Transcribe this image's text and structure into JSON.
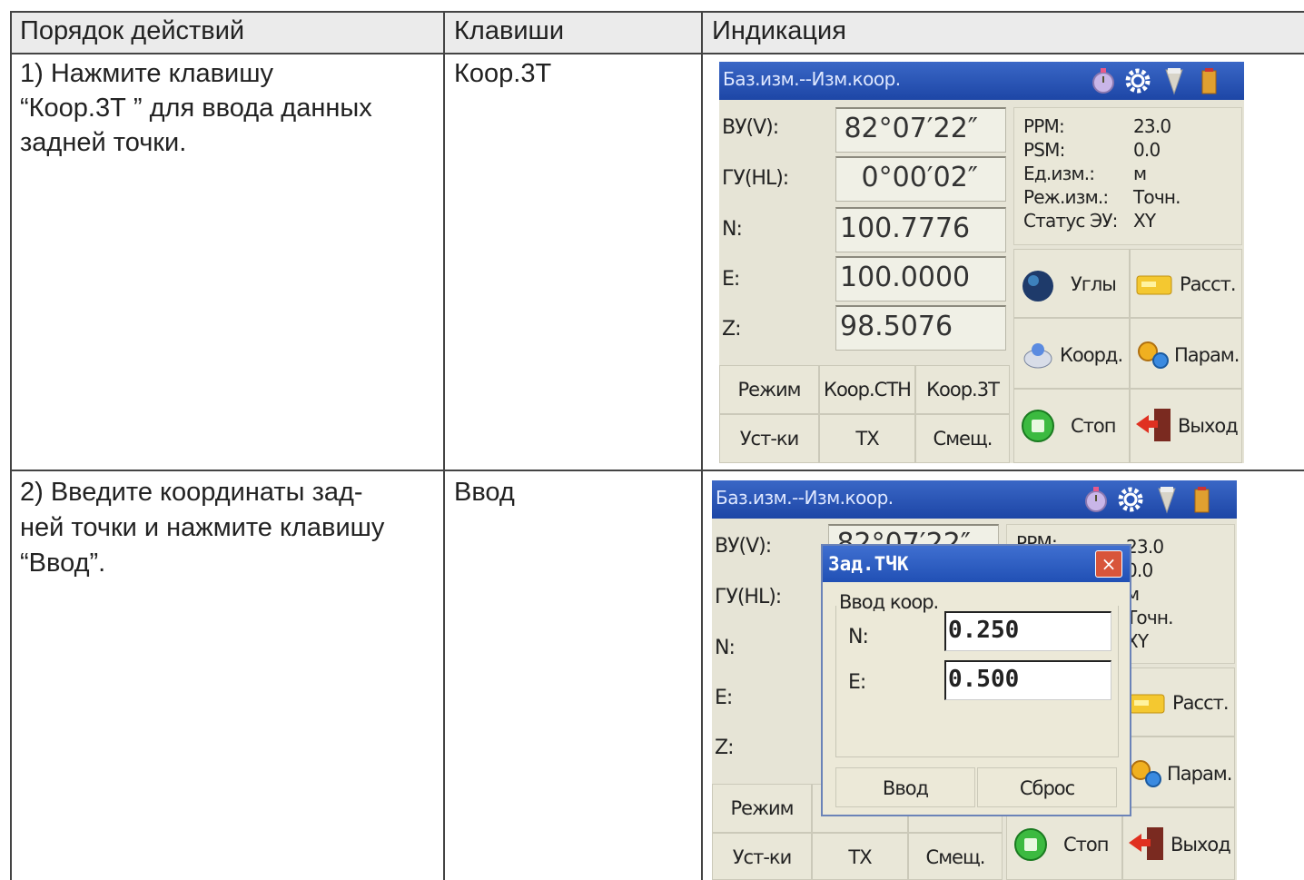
{
  "table": {
    "headers": {
      "steps": "Порядок действий",
      "keys": "Клавиши",
      "display": "Индикация"
    },
    "rows": [
      {
        "step_lines": [
          "1) Нажмите клавишу",
          "“Коор.3Т ” для ввода данных",
          "задней точки."
        ],
        "key": "Коор.3Т"
      },
      {
        "step_lines": [
          "2) Введите координаты зад-",
          "ней точки и нажмите клавишу",
          "“Ввод”."
        ],
        "key": "Ввод"
      }
    ]
  },
  "screen1": {
    "title": "Баз.изм.--Изм.коор.",
    "fields": [
      {
        "label": "ВУ(V):",
        "value": "82°07′22″"
      },
      {
        "label": "ГУ(HL):",
        "value": "0°00′02″"
      },
      {
        "label": "N:",
        "value": "100.7776"
      },
      {
        "label": "E:",
        "value": "100.0000"
      },
      {
        "label": "Z:",
        "value": "98.5076"
      }
    ],
    "info": [
      {
        "key": "PPM:",
        "value": "23.0"
      },
      {
        "key": "PSM:",
        "value": "0.0"
      },
      {
        "key": "Ед.изм.:",
        "value": "м"
      },
      {
        "key": "Реж.изм.:",
        "value": "Точн."
      },
      {
        "key": "Статус ЭУ:",
        "value": "XY"
      }
    ],
    "softkeys": [
      "Режим",
      "Коор.СТН",
      "Коор.3Т",
      "Уст-ки",
      "ТХ",
      "Смещ."
    ],
    "side_buttons": [
      "Углы",
      "Расст.",
      "Коорд.",
      "Парам.",
      "Стоп",
      "Выход"
    ]
  },
  "screen2": {
    "title": "Баз.изм.--Изм.коор.",
    "partial_value": "82°07′22″",
    "labels": [
      "ВУ(V):",
      "ГУ(HL):",
      "N:",
      "E:",
      "Z:"
    ],
    "info_partial": [
      "PPM:",
      "23.0",
      "0.0",
      "м",
      "Точн.",
      "XY"
    ],
    "softkeys": [
      "Режим",
      "Уст-ки",
      "ТХ",
      "Смещ."
    ],
    "side_buttons": [
      "Расст.",
      "Парам.",
      "Стоп",
      "Выход"
    ],
    "dialog": {
      "title": "Зад.ТЧК",
      "close": "×",
      "group_label": "Ввод коор.",
      "n_label": "N:",
      "n_value": "0.250",
      "e_label": "E:",
      "e_value": "0.500",
      "ok": "Ввод",
      "reset": "Сброс"
    }
  },
  "colors": {
    "titlebar": "#2a56b8",
    "screen_bg": "#e6e4d6",
    "header_bg": "#ebebeb"
  }
}
